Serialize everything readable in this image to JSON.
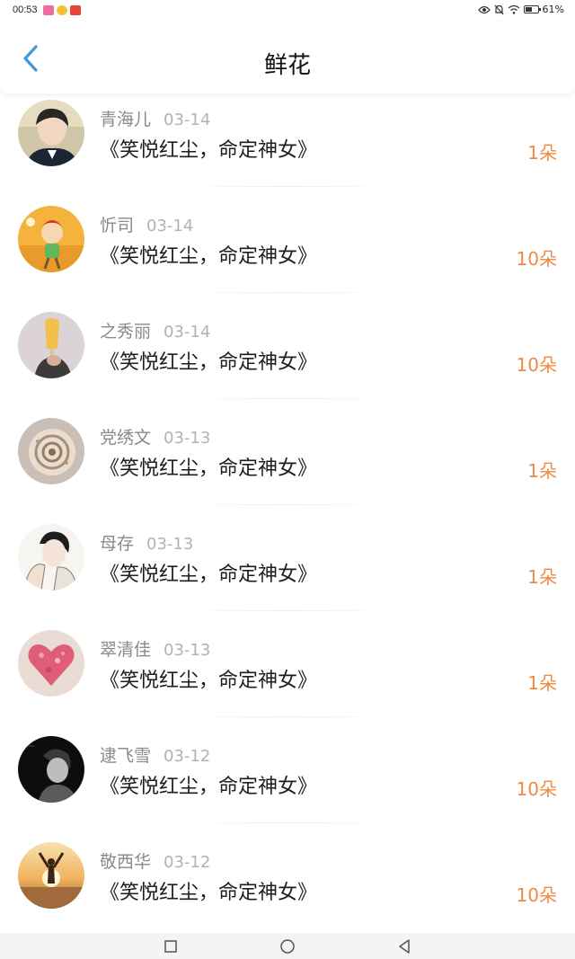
{
  "status_bar": {
    "time": "00:53",
    "battery": "61%",
    "battery_level": 0.61
  },
  "header": {
    "title": "鲜花"
  },
  "colors": {
    "accent": "#3a9bdc",
    "count": "#ee8a44",
    "name": "#8a8a8a",
    "date": "#b2b2b2"
  },
  "gifts": [
    {
      "name": "青海儿",
      "date": "03-14",
      "title": "《笑悦红尘，命定神女》",
      "count": "1朵",
      "avatar": "boy-in-suit-avatar"
    },
    {
      "name": "忻司",
      "date": "03-14",
      "title": "《笑悦红尘，命定神女》",
      "count": "10朵",
      "avatar": "cartoon-child-avatar"
    },
    {
      "name": "之秀丽",
      "date": "03-14",
      "title": "《笑悦红尘，命定神女》",
      "count": "10朵",
      "avatar": "popsicle-avatar"
    },
    {
      "name": "党绣文",
      "date": "03-13",
      "title": "《笑悦红尘，命定神女》",
      "count": "1朵",
      "avatar": "seashell-avatar"
    },
    {
      "name": "母存",
      "date": "03-13",
      "title": "《笑悦红尘，命定神女》",
      "count": "1朵",
      "avatar": "sketch-boy-avatar"
    },
    {
      "name": "翠清佳",
      "date": "03-13",
      "title": "《笑悦红尘，命定神女》",
      "count": "1朵",
      "avatar": "pink-heart-avatar"
    },
    {
      "name": "逮飞雪",
      "date": "03-12",
      "title": "《笑悦红尘，命定神女》",
      "count": "10朵",
      "avatar": "bw-portrait-avatar"
    },
    {
      "name": "敬西华",
      "date": "03-12",
      "title": "《笑悦红尘，命定神女》",
      "count": "10朵",
      "avatar": "sunset-silhouette-avatar"
    }
  ]
}
